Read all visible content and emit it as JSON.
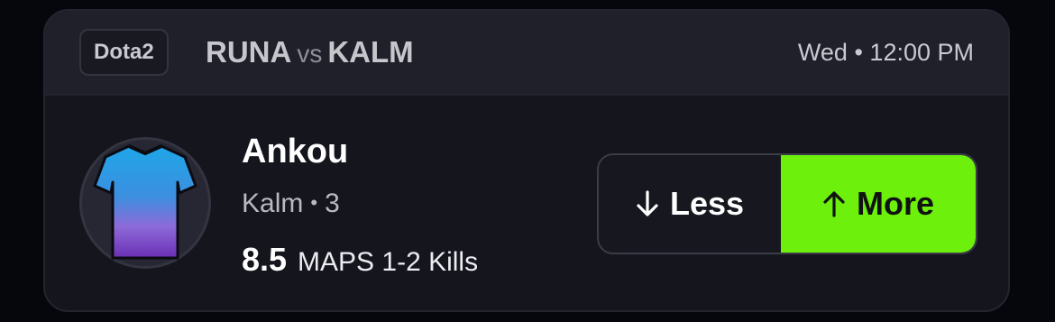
{
  "header": {
    "game": "Dota2",
    "team_home": "RUNA",
    "vs": "vs",
    "team_away": "KALM",
    "day": "Wed",
    "separator": "•",
    "time": "12:00 PM"
  },
  "player": {
    "name": "Ankou",
    "team": "Kalm",
    "separator": "•",
    "position": "3",
    "avatar_icon": "jersey-icon"
  },
  "projection": {
    "line": "8.5",
    "stat": "MAPS 1-2 Kills"
  },
  "picks": {
    "less_label": "Less",
    "less_icon": "arrow-down-icon",
    "more_label": "More",
    "more_icon": "arrow-up-icon",
    "selected": "More",
    "selected_color": "#6cf00c"
  }
}
